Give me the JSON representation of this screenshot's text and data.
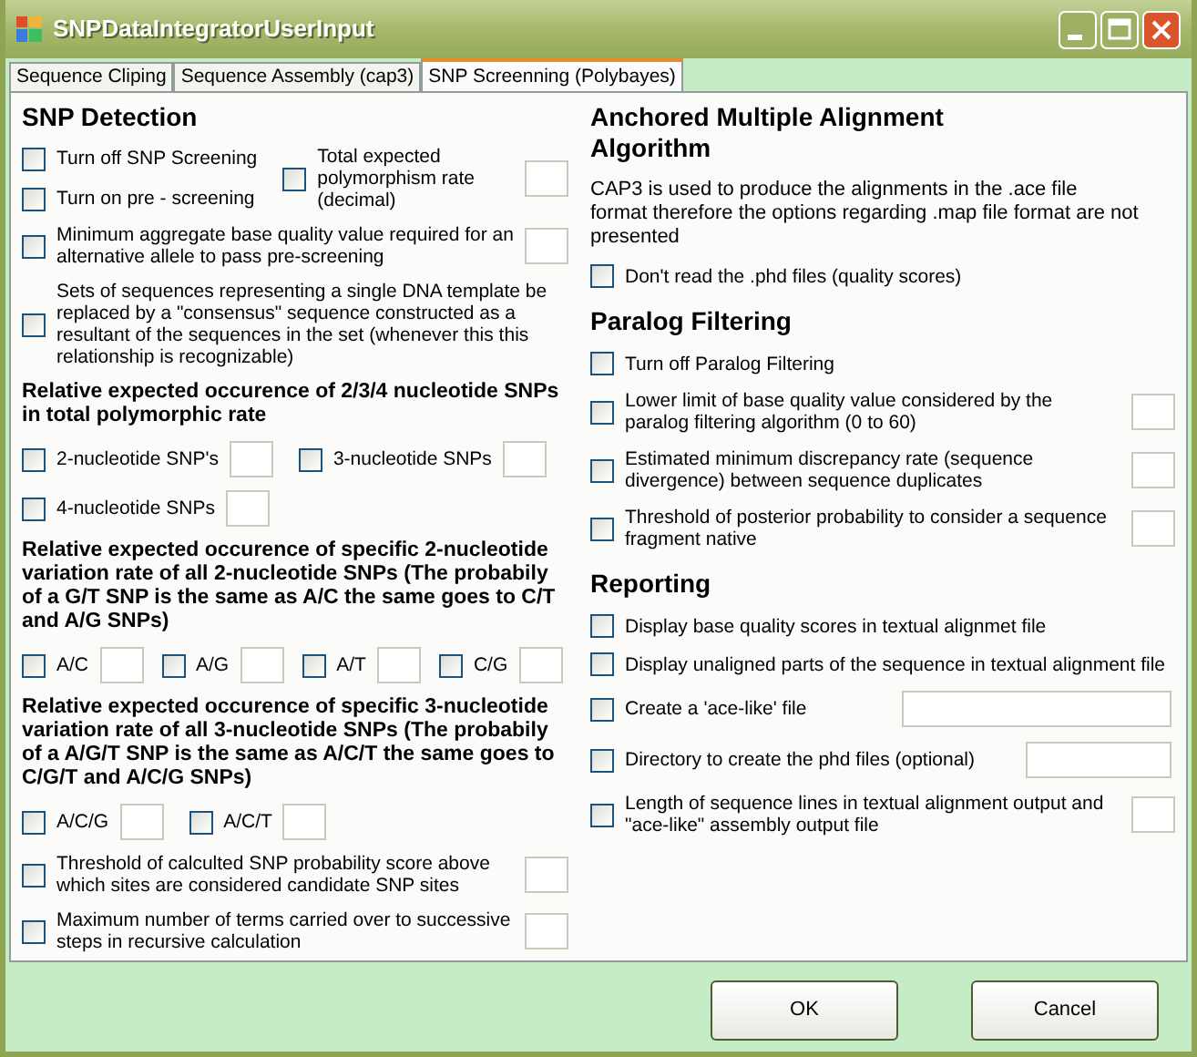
{
  "window": {
    "title": "SNPDataIntegratorUserInput"
  },
  "tabs": [
    {
      "label": "Sequence Cliping",
      "selected": false
    },
    {
      "label": "Sequence Assembly (cap3)",
      "selected": false
    },
    {
      "label": "SNP Screenning (Polybayes)",
      "selected": true
    }
  ],
  "columns": [
    [
      {
        "kind": "heading",
        "text": "SNP Detection"
      },
      {
        "kind": "row",
        "items": [
          {
            "kind": "stack",
            "stack": [
              {
                "kind": "check",
                "label": "Turn off SNP Screening",
                "checked": false
              },
              {
                "kind": "check",
                "label": "Turn on pre - screening",
                "checked": false
              }
            ]
          },
          {
            "kind": "check_box",
            "label": "Total expected polymorphism rate (decimal)",
            "checked": false
          }
        ]
      },
      {
        "kind": "row",
        "items": [
          {
            "kind": "check_box",
            "label": "Minimum aggregate base quality value required for an alternative allele to pass pre-screening",
            "checked": false
          }
        ]
      },
      {
        "kind": "row",
        "items": [
          {
            "kind": "check",
            "label": "Sets of sequences representing a single DNA template be replaced by a \"consensus\" sequence constructed as a resultant of the sequences in the set (whenever this this relationship is recognizable)",
            "checked": false
          }
        ]
      },
      {
        "kind": "subheading",
        "text": "Relative expected occurence of 2/3/4 nucleotide SNPs in total polymorphic rate"
      },
      {
        "kind": "row",
        "items": [
          {
            "kind": "check_box",
            "label": "2-nucleotide SNP's",
            "checked": false
          },
          {
            "kind": "check_box",
            "label": "3-nucleotide SNPs",
            "checked": false
          }
        ]
      },
      {
        "kind": "inline_row",
        "items": [
          {
            "kind": "check_box",
            "label": "4-nucleotide SNPs",
            "checked": false
          }
        ]
      },
      {
        "kind": "subheading",
        "text": "Relative expected occurence of specific 2-nucleotide variation rate of all 2-nucleotide SNPs (The probabily of a G/T SNP is the same as A/C the same goes to C/T and A/G SNPs)"
      },
      {
        "kind": "row",
        "items": [
          {
            "kind": "check_box",
            "label": "A/C",
            "checked": false
          },
          {
            "kind": "check_box",
            "label": "A/G",
            "checked": false
          },
          {
            "kind": "check_box",
            "label": "A/T",
            "checked": false
          },
          {
            "kind": "check_box",
            "label": "C/G",
            "checked": false
          }
        ]
      },
      {
        "kind": "subheading",
        "text": "Relative expected occurence of specific 3-nucleotide variation rate of all 3-nucleotide SNPs (The probabily of a A/G/T SNP is the same as A/C/T the same goes to C/G/T and A/C/G SNPs)"
      },
      {
        "kind": "row",
        "items": [
          {
            "kind": "check_box",
            "label": "A/C/G",
            "checked": false
          },
          {
            "kind": "check_box",
            "label": "A/C/T",
            "checked": false
          }
        ]
      },
      {
        "kind": "row",
        "items": [
          {
            "kind": "check_box",
            "label": "Threshold of calculted SNP probability score above which sites are considered candidate SNP sites",
            "checked": false
          }
        ]
      },
      {
        "kind": "row",
        "items": [
          {
            "kind": "check_box",
            "label": "Maximum number of terms carried over to successive steps in recursive calculation",
            "checked": false
          }
        ]
      }
    ],
    [
      {
        "kind": "heading",
        "text": "Anchored Multiple Alignment Algorithm"
      },
      {
        "kind": "note",
        "text": "CAP3 is used to produce the alignments in the .ace file format therefore the options regarding .map file format are not presented"
      },
      {
        "kind": "row",
        "items": [
          {
            "kind": "check",
            "label": "Don't read the .phd files (quality scores)",
            "checked": false
          }
        ]
      },
      {
        "kind": "heading",
        "text": "Paralog Filtering"
      },
      {
        "kind": "row",
        "items": [
          {
            "kind": "check",
            "label": "Turn off Paralog Filtering",
            "checked": false
          }
        ]
      },
      {
        "kind": "row",
        "items": [
          {
            "kind": "check_box",
            "label": "Lower limit of base quality value considered by the paralog filtering algorithm (0 to 60)",
            "checked": false
          }
        ]
      },
      {
        "kind": "row",
        "items": [
          {
            "kind": "check_box",
            "label": "Estimated minimum discrepancy rate (sequence divergence) between sequence duplicates",
            "checked": false
          }
        ]
      },
      {
        "kind": "row",
        "items": [
          {
            "kind": "check_box",
            "label": "Threshold of posterior probability to consider a sequence fragment native",
            "checked": false
          }
        ]
      },
      {
        "kind": "heading",
        "text": "Reporting"
      },
      {
        "kind": "row",
        "items": [
          {
            "kind": "check",
            "label": "Display base quality scores in textual alignmet file",
            "checked": false
          }
        ]
      },
      {
        "kind": "row",
        "items": [
          {
            "kind": "check",
            "label": "Display unaligned parts of the sequence in textual alignment file",
            "checked": false
          }
        ]
      },
      {
        "kind": "inline_row",
        "items": [
          {
            "kind": "check_wide",
            "label": "Create a 'ace-like' file",
            "checked": false
          }
        ]
      },
      {
        "kind": "inline_row",
        "items": [
          {
            "kind": "check_medium",
            "label": "Directory to create the phd files (optional)",
            "checked": false
          }
        ]
      },
      {
        "kind": "row",
        "items": [
          {
            "kind": "check_box",
            "label": "Length of sequence lines in textual alignment output and \"ace-like\" assembly output file",
            "checked": false
          }
        ]
      }
    ]
  ],
  "buttons": [
    {
      "label": "OK"
    },
    {
      "label": "Cancel"
    }
  ]
}
